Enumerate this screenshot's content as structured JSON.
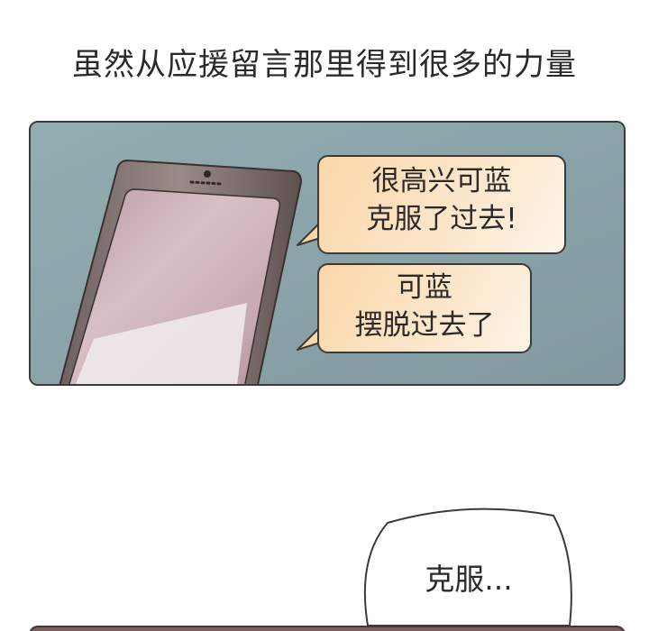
{
  "caption": "虽然从应援留言那里得到很多的力量",
  "bubble_1": {
    "line_1": "很高兴可蓝",
    "line_2": "克服了过去!"
  },
  "bubble_2": {
    "line_1": "可蓝",
    "line_2": "摆脱过去了"
  },
  "bottom_bubble": {
    "text": "克服..."
  },
  "colors": {
    "panel_background": "#8fa8ac",
    "bubble_fill": "#fbd6a8",
    "phone_body": "#8a7b7a",
    "screen": "#c9a9b1"
  }
}
